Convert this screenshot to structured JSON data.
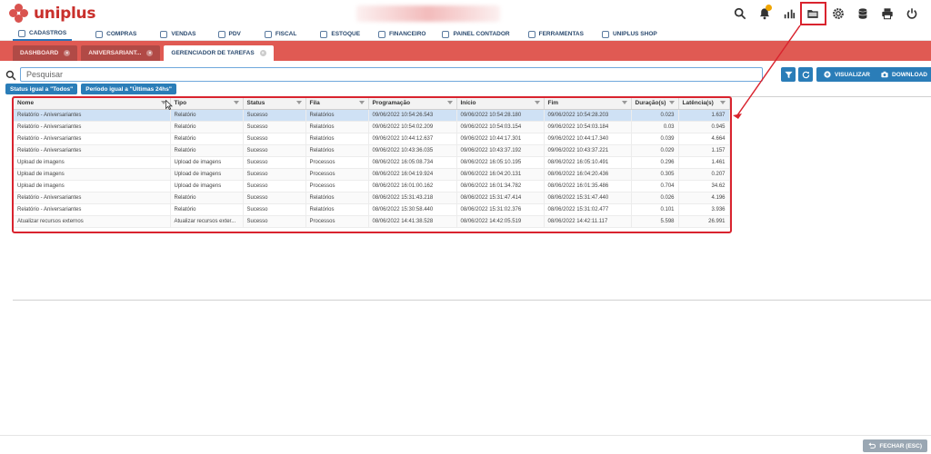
{
  "app": {
    "logo_text": "uniplus"
  },
  "menu": [
    {
      "label": "CADASTROS",
      "active": true
    },
    {
      "label": "COMPRAS"
    },
    {
      "label": "VENDAS"
    },
    {
      "label": "PDV"
    },
    {
      "label": "FISCAL"
    },
    {
      "label": "ESTOQUE"
    },
    {
      "label": "FINANCEIRO"
    },
    {
      "label": "PAINEL CONTADOR"
    },
    {
      "label": "FERRAMENTAS"
    },
    {
      "label": "UNIPLUS SHOP"
    }
  ],
  "tabs": [
    {
      "label": "DASHBOARD"
    },
    {
      "label": "ANIVERSARIANT..."
    },
    {
      "label": "GERENCIADOR DE TAREFAS",
      "active": true
    }
  ],
  "search": {
    "placeholder": "Pesquisar"
  },
  "actions": {
    "visualizar": "VISUALIZAR",
    "download": "DOWNLOAD"
  },
  "filters": [
    "Status igual a \"Todos\"",
    "Período igual a \"Últimas 24hs\""
  ],
  "grid": {
    "columns": [
      "Nome",
      "Tipo",
      "Status",
      "Fila",
      "Programação",
      "Início",
      "Fim",
      "Duração(s)",
      "Latência(s)"
    ],
    "rows": [
      [
        "Relatório - Aniversariantes",
        "Relatório",
        "Sucesso",
        "Relatórios",
        "09/06/2022 10:54:26.543",
        "09/06/2022 10:54:28.180",
        "09/06/2022 10:54:28.203",
        "0.023",
        "1.637"
      ],
      [
        "Relatório - Aniversariantes",
        "Relatório",
        "Sucesso",
        "Relatórios",
        "09/06/2022 10:54:02.209",
        "09/06/2022 10:54:03.154",
        "09/06/2022 10:54:03.184",
        "0.03",
        "0.945"
      ],
      [
        "Relatório - Aniversariantes",
        "Relatório",
        "Sucesso",
        "Relatórios",
        "09/06/2022 10:44:12.637",
        "09/06/2022 10:44:17.301",
        "09/06/2022 10:44:17.340",
        "0.039",
        "4.664"
      ],
      [
        "Relatório - Aniversariantes",
        "Relatório",
        "Sucesso",
        "Relatórios",
        "09/06/2022 10:43:36.035",
        "09/06/2022 10:43:37.192",
        "09/06/2022 10:43:37.221",
        "0.029",
        "1.157"
      ],
      [
        "Upload de imagens",
        "Upload de imagens",
        "Sucesso",
        "Processos",
        "08/06/2022 16:05:08.734",
        "08/06/2022 16:05:10.195",
        "08/06/2022 16:05:10.491",
        "0.296",
        "1.461"
      ],
      [
        "Upload de imagens",
        "Upload de imagens",
        "Sucesso",
        "Processos",
        "08/06/2022 16:04:19.924",
        "08/06/2022 16:04:20.131",
        "08/06/2022 16:04:20.436",
        "0.305",
        "0.207"
      ],
      [
        "Upload de imagens",
        "Upload de imagens",
        "Sucesso",
        "Processos",
        "08/06/2022 16:01:00.162",
        "08/06/2022 16:01:34.782",
        "08/06/2022 16:01:35.486",
        "0.704",
        "34.62"
      ],
      [
        "Relatório - Aniversariantes",
        "Relatório",
        "Sucesso",
        "Relatórios",
        "08/06/2022 15:31:43.218",
        "08/06/2022 15:31:47.414",
        "08/06/2022 15:31:47.440",
        "0.026",
        "4.196"
      ],
      [
        "Relatório - Aniversariantes",
        "Relatório",
        "Sucesso",
        "Relatórios",
        "08/06/2022 15:30:58.440",
        "08/06/2022 15:31:02.376",
        "08/06/2022 15:31:02.477",
        "0.101",
        "3.936"
      ],
      [
        "Atualizar recursos externos",
        "Atualizar recursos exter...",
        "Sucesso",
        "Processos",
        "08/06/2022 14:41:38.528",
        "08/06/2022 14:42:05.519",
        "08/06/2022 14:42:11.117",
        "5.598",
        "26.991"
      ]
    ]
  },
  "footer": {
    "close_label": "FECHAR (ESC)"
  },
  "colors": {
    "accent": "#2a7db8",
    "tabbar": "#e05a53",
    "annotation": "#d9232e",
    "brand": "#c9302c"
  }
}
